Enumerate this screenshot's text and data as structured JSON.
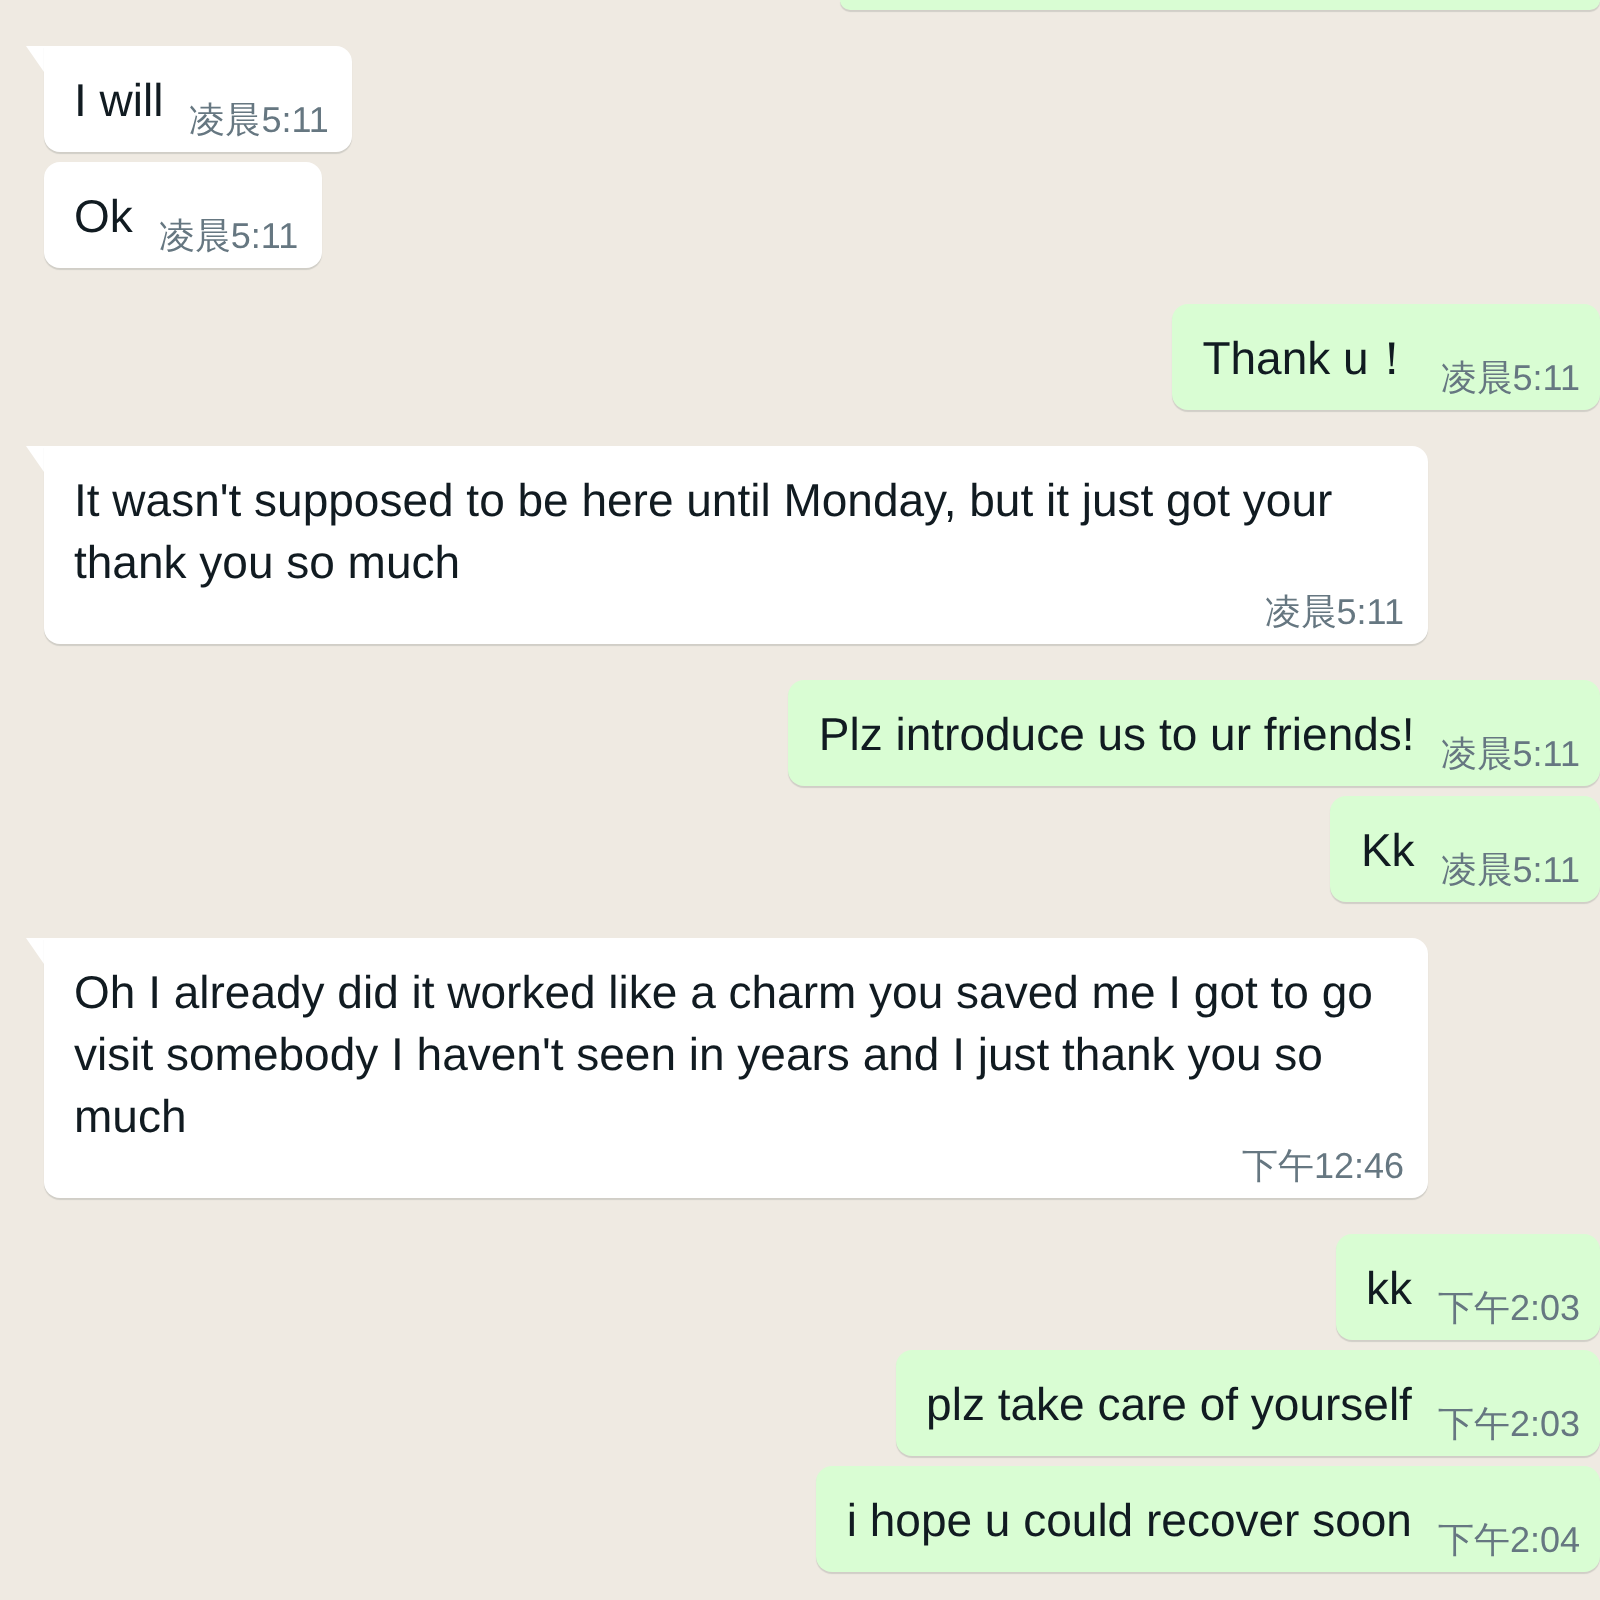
{
  "chat": {
    "messages": [
      {
        "outgoing": true,
        "kind": "clipped"
      },
      {
        "outgoing": false,
        "kind": "text",
        "tail": true,
        "text": "I will",
        "time": "凌晨5:11"
      },
      {
        "outgoing": false,
        "kind": "text",
        "tail": false,
        "text": "Ok",
        "time": "凌晨5:11"
      },
      {
        "outgoing": true,
        "kind": "text",
        "tail": false,
        "text": "Thank u！",
        "time": "凌晨5:11"
      },
      {
        "outgoing": false,
        "kind": "text",
        "tail": true,
        "text": "It wasn't supposed to be here until Monday, but it just got your thank you so much",
        "time": "凌晨5:11"
      },
      {
        "outgoing": true,
        "kind": "text",
        "tail": false,
        "text": "Plz introduce us to ur friends!",
        "time": "凌晨5:11"
      },
      {
        "outgoing": true,
        "kind": "text",
        "tail": false,
        "text": "Kk",
        "time": "凌晨5:11"
      },
      {
        "outgoing": false,
        "kind": "text",
        "tail": true,
        "text": "Oh I already did it worked like a charm you saved me I got to go visit somebody I haven't seen in years and I just thank you so much",
        "time": "下午12:46"
      },
      {
        "outgoing": true,
        "kind": "text",
        "tail": false,
        "text": "kk",
        "time": "下午2:03"
      },
      {
        "outgoing": true,
        "kind": "text",
        "tail": false,
        "text": "plz take care of yourself",
        "time": "下午2:03"
      },
      {
        "outgoing": true,
        "kind": "text",
        "tail": false,
        "text": "i hope u could recover soon",
        "time": "下午2:04"
      }
    ]
  }
}
